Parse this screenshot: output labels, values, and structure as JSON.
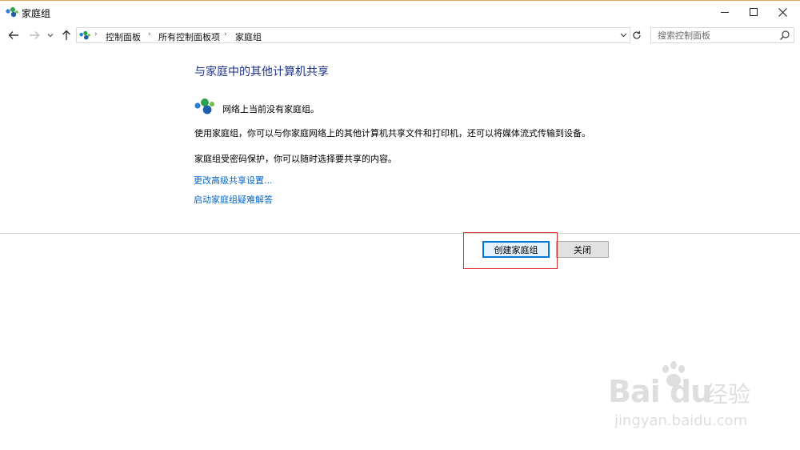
{
  "window": {
    "title": "家庭组",
    "accent_color": "#e8a15c"
  },
  "nav": {
    "back_icon": "arrow-left-icon",
    "forward_icon": "arrow-right-icon",
    "recent_icon": "chevron-down-icon",
    "up_icon": "arrow-up-icon"
  },
  "address": {
    "crumbs": [
      "控制面板",
      "所有控制面板项",
      "家庭组"
    ],
    "separator": "›"
  },
  "search": {
    "placeholder": "搜索控制面板"
  },
  "main": {
    "title": "与家庭中的其他计算机共享",
    "title_color": "#1e3287",
    "status": "网络上当前没有家庭组。",
    "description": "使用家庭组，你可以与你家庭网络上的其他计算机共享文件和打印机，还可以将媒体流式传输到设备。",
    "password_note": "家庭组受密码保护，你可以随时选择要共享的内容。",
    "links": [
      "更改高级共享设置...",
      "启动家庭组疑难解答"
    ],
    "link_color": "#0066cc"
  },
  "buttons": {
    "create": "创建家庭组",
    "close": "关闭"
  },
  "highlight": {
    "color": "#e02a2a"
  },
  "watermark": {
    "brand": "Bai du",
    "cn": "经验",
    "url": "jingyan.baidu.com"
  }
}
